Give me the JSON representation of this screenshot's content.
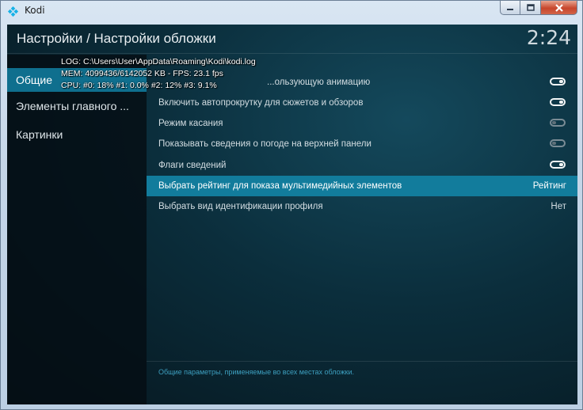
{
  "window": {
    "title": "Kodi",
    "icon": "kodi-icon",
    "controls": [
      "minimize-icon",
      "maximize-icon",
      "close-icon"
    ]
  },
  "header": {
    "title": "Настройки / Настройки обложки",
    "clock": "2:24"
  },
  "debug": {
    "log": "LOG: C:\\Users\\User\\AppData\\Roaming\\Kodi\\kodi.log",
    "mem": "MEM: 4099436/6142052 KB - FPS: 23.1 fps",
    "cpu": "CPU: #0:  18% #1: 0.0% #2:  12% #3:  9.1%"
  },
  "sidebar": {
    "items": [
      {
        "label": "Общие",
        "active": true
      },
      {
        "label": "Элементы главного ...",
        "active": false
      },
      {
        "label": "Картинки",
        "active": false
      }
    ]
  },
  "settings": {
    "rows": [
      {
        "label": "Использовать анимацию",
        "visible_label": "...ользующую анимацию",
        "control": "toggle",
        "state": "on"
      },
      {
        "label": "Включить автопрокрутку для сюжетов и обзоров",
        "control": "toggle",
        "state": "on"
      },
      {
        "label": "Режим касания",
        "control": "toggle",
        "state": "off"
      },
      {
        "label": "Показывать сведения о погоде на верхней панели",
        "control": "toggle",
        "state": "off"
      },
      {
        "label": "Флаги сведений",
        "control": "toggle",
        "state": "on"
      },
      {
        "label": "Выбрать рейтинг для показа мультимедийных элементов",
        "control": "value",
        "value": "Рейтинг",
        "focused": true
      },
      {
        "label": "Выбрать вид идентификации профиля",
        "control": "value",
        "value": "Нет"
      }
    ]
  },
  "footer": {
    "description": "Общие параметры, применяемые во всех местах обложки."
  },
  "colors": {
    "accent": "#127c9c",
    "sidebar_active": "#0f6f8e",
    "footer_text": "#3d9fbf"
  }
}
